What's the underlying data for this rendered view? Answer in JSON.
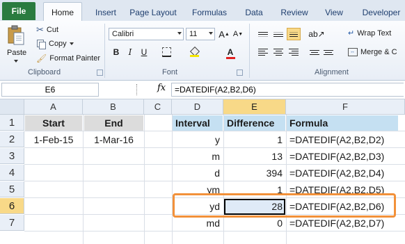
{
  "ribbon_tabs": [
    "File",
    "Home",
    "Insert",
    "Page Layout",
    "Formulas",
    "Data",
    "Review",
    "View",
    "Developer"
  ],
  "clipboard": {
    "paste_label": "Paste",
    "cut_label": "Cut",
    "copy_label": "Copy",
    "format_painter_label": "Format Painter",
    "group_label": "Clipboard"
  },
  "font": {
    "name": "Calibri",
    "size": "11",
    "bold": "B",
    "italic": "I",
    "underline": "U",
    "grow": "A",
    "shrink": "A",
    "font_color": "A",
    "group_label": "Font"
  },
  "alignment": {
    "wrap_text_label": "Wrap Text",
    "merge_label": "Merge & C",
    "group_label": "Alignment"
  },
  "formula_bar": {
    "name_box": "E6",
    "fx": "fx",
    "formula": "=DATEDIF(A2,B2,D6)"
  },
  "columns": [
    "A",
    "B",
    "C",
    "D",
    "E",
    "F"
  ],
  "rows": [
    "1",
    "2",
    "3",
    "4",
    "5",
    "6",
    "7"
  ],
  "cells": {
    "A1": "Start",
    "B1": "End",
    "D1": "Interval",
    "E1": "Difference",
    "F1": "Formula",
    "A2": "1-Feb-15",
    "B2": "1-Mar-16",
    "D2": "y",
    "E2": "1",
    "F2": "=DATEDIF(A2,B2,D2)",
    "D3": "m",
    "E3": "13",
    "F3": "=DATEDIF(A2,B2,D3)",
    "D4": "d",
    "E4": "394",
    "F4": "=DATEDIF(A2,B2,D4)",
    "D5": "ym",
    "E5": "1",
    "F5": "=DATEDIF(A2,B2,D5)",
    "D6": "yd",
    "E6": "28",
    "F6": "=DATEDIF(A2,B2,D6)",
    "D7": "md",
    "E7": "0",
    "F7": "=DATEDIF(A2,B2,D7)"
  },
  "colors": {
    "file_tab": "#2a7b3f",
    "selected_header": "#f8d988",
    "highlight_box": "#f2913a",
    "table_header_blue": "#c5e0f2",
    "table_header_gray": "#dcdcdc"
  }
}
